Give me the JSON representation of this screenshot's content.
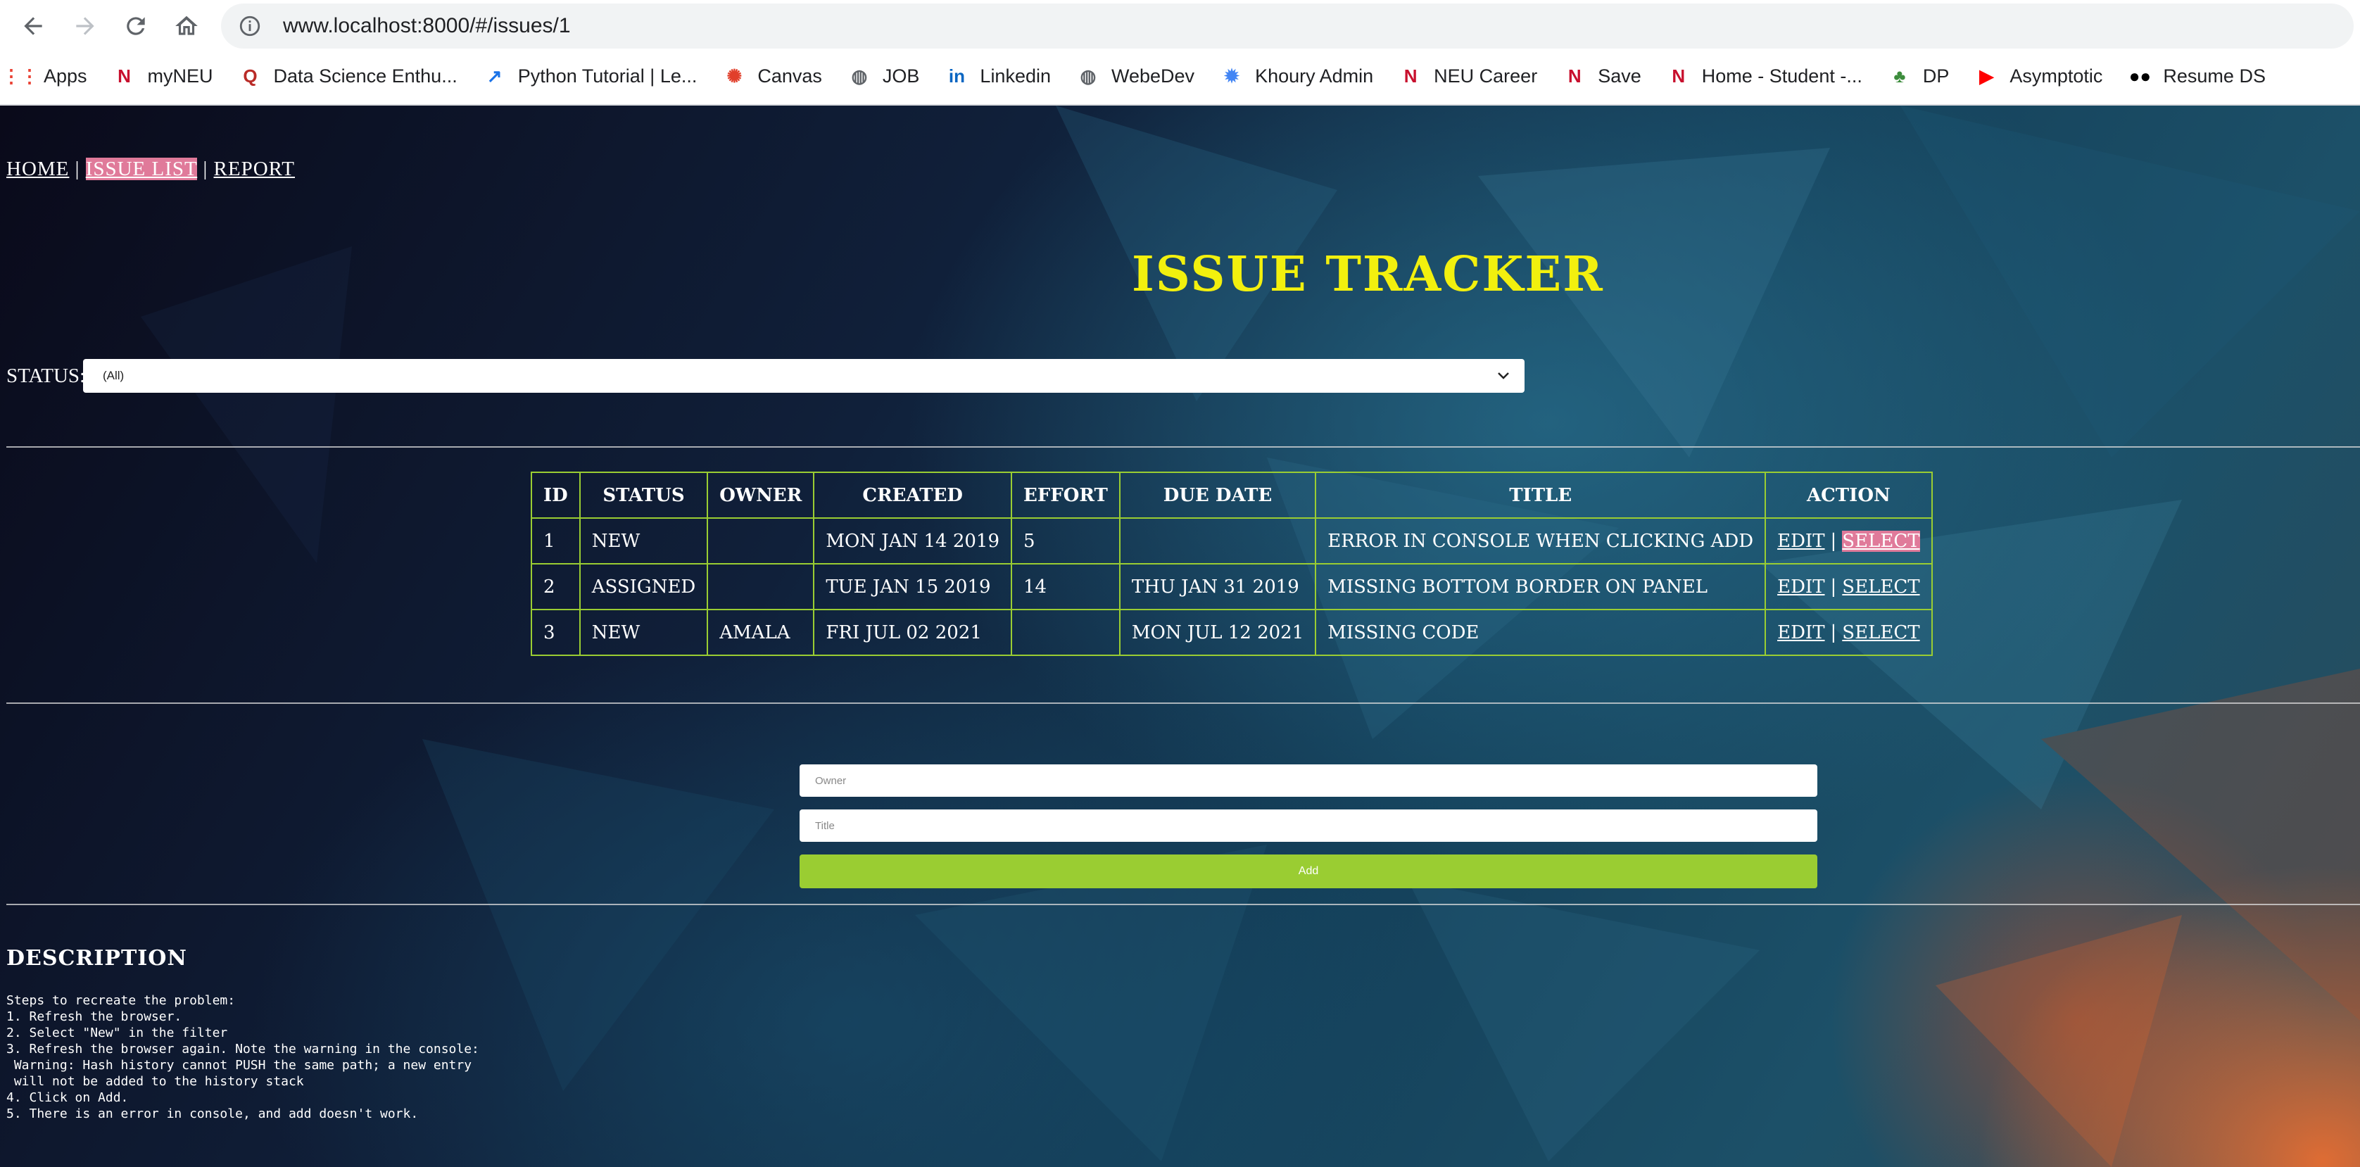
{
  "browser": {
    "url": "www.localhost:8000/#/issues/1",
    "bookmarks": [
      {
        "label": "Apps",
        "icon": "apps-grid-icon",
        "color": "#ea4335"
      },
      {
        "label": "myNEU",
        "icon": "neu-logo-icon",
        "color": "#c8102e"
      },
      {
        "label": "Data Science Enthu...",
        "icon": "quora-logo-icon",
        "color": "#b92b27"
      },
      {
        "label": "Python Tutorial | Le...",
        "icon": "chart-line-icon",
        "color": "#1a73e8"
      },
      {
        "label": "Canvas",
        "icon": "canvas-logo-icon",
        "color": "#e13f2b"
      },
      {
        "label": "JOB",
        "icon": "globe-icon",
        "color": "#5f6368"
      },
      {
        "label": "Linkedin",
        "icon": "linkedin-logo-icon",
        "color": "#0a66c2"
      },
      {
        "label": "WebeDev",
        "icon": "globe-icon",
        "color": "#5f6368"
      },
      {
        "label": "Khoury Admin",
        "icon": "aperture-icon",
        "color": "#4285f4"
      },
      {
        "label": "NEU Career",
        "icon": "neu-logo-icon",
        "color": "#c8102e"
      },
      {
        "label": "Save",
        "icon": "neu-logo-icon",
        "color": "#c8102e"
      },
      {
        "label": "Home - Student -...",
        "icon": "neu-logo-icon",
        "color": "#c8102e"
      },
      {
        "label": "DP",
        "icon": "leaf-icon",
        "color": "#3c8c3c"
      },
      {
        "label": "Asymptotic",
        "icon": "youtube-logo-icon",
        "color": "#ff0000"
      },
      {
        "label": "Resume DS",
        "icon": "medium-logo-icon",
        "color": "#000000"
      }
    ]
  },
  "nav": {
    "home": "HOME",
    "sep1": "|",
    "issue_list": "ISSUE LIST",
    "sep2": "|",
    "report": "REPORT"
  },
  "app_title": "ISSUE TRACKER",
  "filter": {
    "label": "STATUS:",
    "selected": "(All)"
  },
  "table": {
    "headers": [
      "ID",
      "STATUS",
      "OWNER",
      "CREATED",
      "EFFORT",
      "DUE DATE",
      "TITLE",
      "ACTION"
    ],
    "rows": [
      {
        "id": "1",
        "status": "NEW",
        "owner": "",
        "created": "MON JAN 14 2019",
        "effort": "5",
        "due": "",
        "title": "ERROR IN CONSOLE WHEN CLICKING ADD",
        "edit": "EDIT",
        "sep": "|",
        "select": "SELECT"
      },
      {
        "id": "2",
        "status": "ASSIGNED",
        "owner": "",
        "created": "TUE JAN 15 2019",
        "effort": "14",
        "due": "THU JAN 31 2019",
        "title": "MISSING BOTTOM BORDER ON PANEL",
        "edit": "EDIT",
        "sep": "|",
        "select": "SELECT"
      },
      {
        "id": "3",
        "status": "NEW",
        "owner": "AMALA",
        "created": "FRI JUL 02 2021",
        "effort": "",
        "due": "MON JUL 12 2021",
        "title": "MISSING CODE",
        "edit": "EDIT",
        "sep": "|",
        "select": "SELECT"
      }
    ]
  },
  "add_form": {
    "owner_placeholder": "Owner",
    "title_placeholder": "Title",
    "button": "Add"
  },
  "description": {
    "title": "DESCRIPTION",
    "body": "Steps to recreate the problem:\n1. Refresh the browser.\n2. Select \"New\" in the filter\n3. Refresh the browser again. Note the warning in the console:\n Warning: Hash history cannot PUSH the same path; a new entry\n will not be added to the history stack\n4. Click on Add.\n5. There is an error in console, and add doesn't work."
  },
  "colors": {
    "title_yellow": "#f2f00e",
    "accent_green": "#9acd32",
    "highlight_pink": "#e07a9a"
  }
}
